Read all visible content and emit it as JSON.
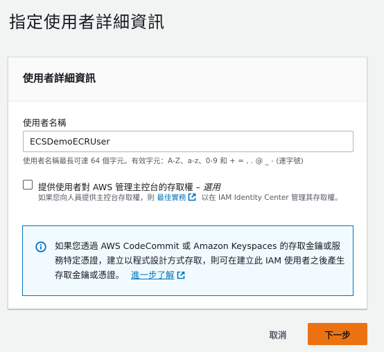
{
  "page": {
    "title": "指定使用者詳細資訊"
  },
  "panel": {
    "header": "使用者詳細資訊",
    "username": {
      "label": "使用者名稱",
      "value": "ECSDemoECRUser",
      "hint": "使用者名稱最長可達 64 個字元。有效字元：A-Z、a-z、0-9 和 + = , . @ _ - (連字號)"
    },
    "console_access": {
      "label": "提供使用者對 AWS 管理主控台的存取權 – ",
      "label_optional": "選用",
      "checked": false,
      "desc_prefix": "如果您向人員提供主控台存取權，則 ",
      "desc_link": "最佳實務",
      "desc_suffix": " 以在 IAM Identity Center 管理其存取權。"
    },
    "info": {
      "text": "如果您透過 AWS CodeCommit 或 Amazon Keyspaces 的存取金鑰或服務特定憑證，建立以程式設計方式存取，則可在建立此 IAM 使用者之後產生存取金鑰或憑證。",
      "link": "進一步了解"
    }
  },
  "actions": {
    "cancel": "取消",
    "next": "下一步"
  },
  "colors": {
    "primary": "#ec7211",
    "link": "#0073bb",
    "info_bg": "#f1faff"
  },
  "icons": [
    "external-link-icon",
    "info-icon"
  ]
}
